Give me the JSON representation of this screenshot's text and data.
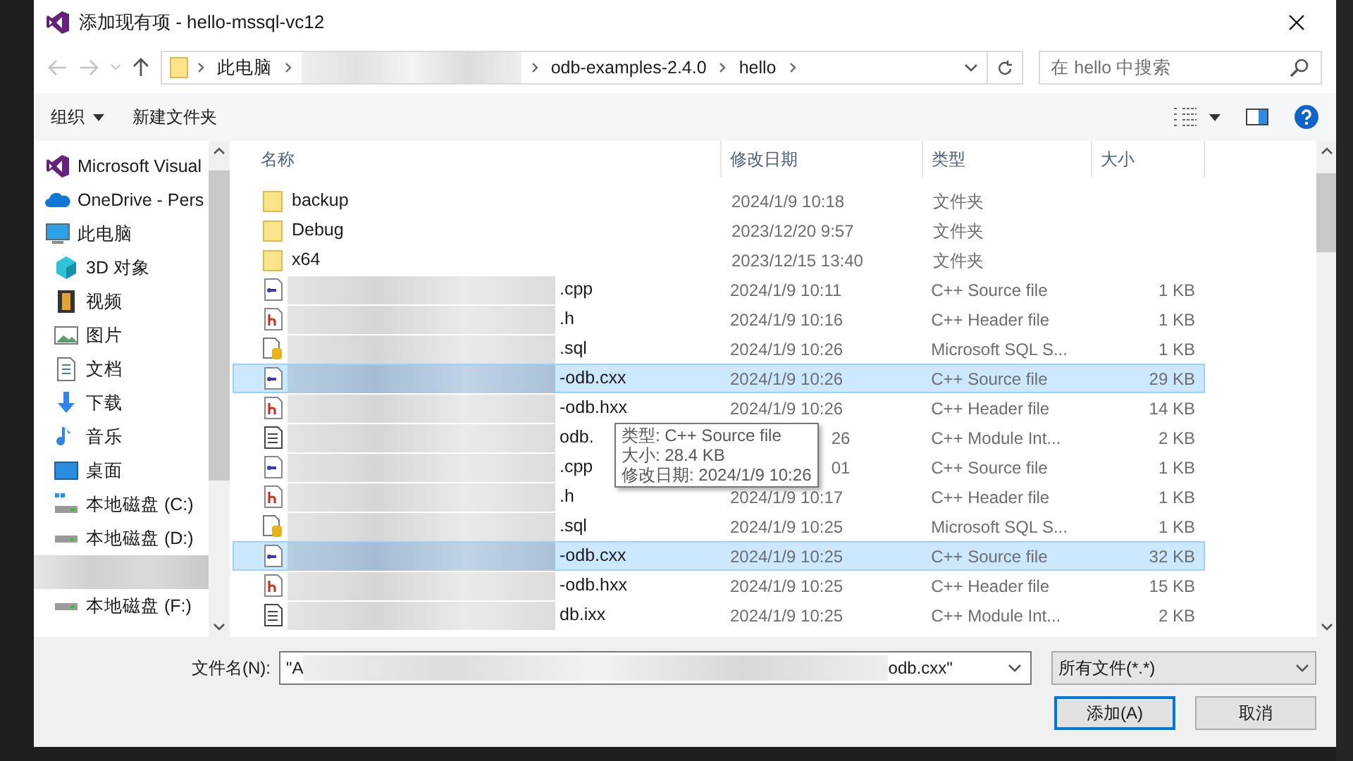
{
  "window": {
    "title": "添加现有项 - hello-mssql-vc12"
  },
  "address": {
    "crumbs": [
      {
        "kind": "text",
        "label": "此电脑"
      },
      {
        "kind": "redacted"
      },
      {
        "kind": "text",
        "label": "odb-examples-2.4.0"
      },
      {
        "kind": "text",
        "label": "hello"
      }
    ]
  },
  "search": {
    "placeholder": "在 hello 中搜索"
  },
  "toolbar": {
    "organize": "组织",
    "new_folder": "新建文件夹"
  },
  "sidebar": {
    "items": [
      {
        "kind": "vs",
        "label": "Microsoft Visual",
        "indent": false,
        "selected": false
      },
      {
        "kind": "cloud",
        "label": "OneDrive - Pers",
        "indent": false,
        "selected": false
      },
      {
        "kind": "pc",
        "label": "此电脑",
        "indent": false,
        "selected": false
      },
      {
        "kind": "cube",
        "label": "3D 对象",
        "indent": true,
        "selected": false
      },
      {
        "kind": "film",
        "label": "视频",
        "indent": true,
        "selected": false
      },
      {
        "kind": "image",
        "label": "图片",
        "indent": true,
        "selected": false
      },
      {
        "kind": "doc",
        "label": "文档",
        "indent": true,
        "selected": false
      },
      {
        "kind": "download",
        "label": "下载",
        "indent": true,
        "selected": false
      },
      {
        "kind": "music",
        "label": "音乐",
        "indent": true,
        "selected": false
      },
      {
        "kind": "desktop",
        "label": "桌面",
        "indent": true,
        "selected": false
      },
      {
        "kind": "sysdrive",
        "label": "本地磁盘 (C:)",
        "indent": true,
        "selected": false
      },
      {
        "kind": "drive",
        "label": "本地磁盘 (D:)",
        "indent": true,
        "selected": false
      },
      {
        "kind": "redacted",
        "selected": true
      },
      {
        "kind": "drive",
        "label": "本地磁盘 (F:)",
        "indent": true,
        "selected": false
      }
    ]
  },
  "table": {
    "columns": [
      "名称",
      "修改日期",
      "类型",
      "大小"
    ],
    "rows": [
      {
        "kind": "folder",
        "name": "backup",
        "redacted": false,
        "date": "2024/1/9 10:18",
        "type": "文件夹",
        "selected": false
      },
      {
        "kind": "folder",
        "name": "Debug",
        "redacted": false,
        "date": "2023/12/20 9:57",
        "type": "文件夹",
        "selected": false
      },
      {
        "kind": "folder",
        "name": "x64",
        "redacted": false,
        "date": "2023/12/15 13:40",
        "type": "文件夹",
        "selected": false
      },
      {
        "kind": "cpp",
        "name": ".cpp",
        "redacted": true,
        "date": "2024/1/9 10:11",
        "type": "C++ Source file",
        "size": "1 KB",
        "selected": false
      },
      {
        "kind": "h",
        "name": ".h",
        "redacted": true,
        "date": "2024/1/9 10:16",
        "type": "C++ Header file",
        "size": "1 KB",
        "selected": false
      },
      {
        "kind": "sql",
        "name": ".sql",
        "redacted": true,
        "date": "2024/1/9 10:26",
        "type": "Microsoft SQL S...",
        "size": "1 KB",
        "selected": false
      },
      {
        "kind": "cpp",
        "name": "-odb.cxx",
        "redacted": true,
        "date": "2024/1/9 10:26",
        "type": "C++ Source file",
        "size": "29 KB",
        "selected": true
      },
      {
        "kind": "h",
        "name": "-odb.hxx",
        "redacted": true,
        "date": "2024/1/9 10:26",
        "type": "C++ Header file",
        "size": "14 KB",
        "selected": false
      },
      {
        "kind": "ixx",
        "name": "odb.",
        "redacted": true,
        "date": "26",
        "type": "C++ Module Int...",
        "size": "2 KB",
        "selected": false
      },
      {
        "kind": "cpp",
        "name": ".cpp",
        "redacted": true,
        "date": "01",
        "type": "C++ Source file",
        "size": "1 KB",
        "selected": false
      },
      {
        "kind": "h",
        "name": ".h",
        "redacted": true,
        "date": "2024/1/9 10:17",
        "type": "C++ Header file",
        "size": "1 KB",
        "selected": false
      },
      {
        "kind": "sql",
        "name": ".sql",
        "redacted": true,
        "date": "2024/1/9 10:25",
        "type": "Microsoft SQL S...",
        "size": "1 KB",
        "selected": false
      },
      {
        "kind": "cpp",
        "name": "-odb.cxx",
        "redacted": true,
        "date": "2024/1/9 10:25",
        "type": "C++ Source file",
        "size": "32 KB",
        "selected": true
      },
      {
        "kind": "h",
        "name": "-odb.hxx",
        "redacted": true,
        "date": "2024/1/9 10:25",
        "type": "C++ Header file",
        "size": "15 KB",
        "selected": false
      },
      {
        "kind": "ixx",
        "name": "db.ixx",
        "redacted": true,
        "date": "2024/1/9 10:25",
        "type": "C++ Module Int...",
        "size": "2 KB",
        "selected": false
      }
    ]
  },
  "tooltip": {
    "lines": [
      "类型: C++ Source file",
      "大小: 28.4 KB",
      "修改日期: 2024/1/9 10:26"
    ]
  },
  "footer": {
    "filename_label": "文件名(N):",
    "filename_start": "\"A",
    "filename_end": "odb.cxx\"",
    "filter": "所有文件(*.*)",
    "buttons": [
      {
        "label": "添加(A)",
        "primary": true
      },
      {
        "label": "取消",
        "primary": false
      }
    ]
  }
}
